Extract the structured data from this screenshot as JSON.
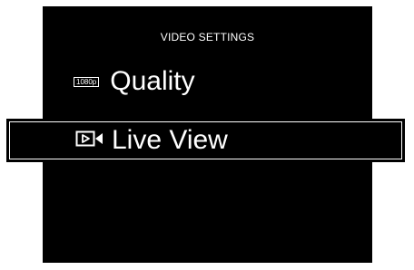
{
  "header": {
    "title": "VIDEO SETTINGS"
  },
  "menu": {
    "items": [
      {
        "label": "Quality",
        "icon": "resolution-badge-icon",
        "icon_text": "1080p"
      },
      {
        "label": "Live View",
        "icon": "live-view-camera-icon",
        "selected": true
      }
    ]
  },
  "colors": {
    "screen_background": "#000000",
    "text": "#ffffff",
    "selection_outline": "#ffffff"
  }
}
